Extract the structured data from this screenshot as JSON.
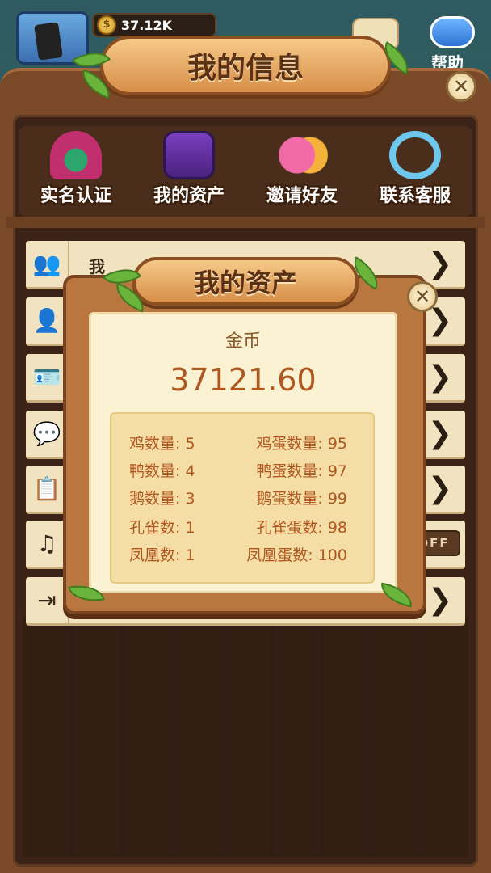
{
  "hud": {
    "coins": "37.12K",
    "help_label": "帮助"
  },
  "panel": {
    "title": "我的信息",
    "close_glyph": "✕"
  },
  "icon_row": [
    {
      "label": "实名认证",
      "icon": "realname-icon"
    },
    {
      "label": "我的资产",
      "icon": "assets-icon"
    },
    {
      "label": "邀请好友",
      "icon": "invite-icon"
    },
    {
      "label": "联系客服",
      "icon": "service-icon"
    }
  ],
  "list": [
    {
      "icon": "users-icon",
      "glyph": "👥",
      "text": "我"
    },
    {
      "icon": "add-user-icon",
      "glyph": "👤"
    },
    {
      "icon": "profile-card-icon",
      "glyph": "🪪"
    },
    {
      "icon": "chat-icon",
      "glyph": "💬"
    },
    {
      "icon": "clipboard-icon",
      "glyph": "📋"
    },
    {
      "icon": "music-icon",
      "glyph": "♫",
      "toggle": "OFF"
    },
    {
      "icon": "logout-icon",
      "glyph": "⇥"
    }
  ],
  "dialog": {
    "title": "我的资产",
    "close_glyph": "✕",
    "coin_label": "金币",
    "coin_value": "37121.60",
    "stats_left": [
      "鸡数量: 5",
      "鸭数量: 4",
      "鹅数量: 3",
      "孔雀数: 1",
      "凤凰数: 1"
    ],
    "stats_right": [
      "鸡蛋数量: 95",
      "鸭蛋数量: 97",
      "鹅蛋数量: 99",
      "孔雀蛋数: 98",
      "凤凰蛋数: 100"
    ]
  },
  "chevron": "❯",
  "coin_symbol": "$"
}
